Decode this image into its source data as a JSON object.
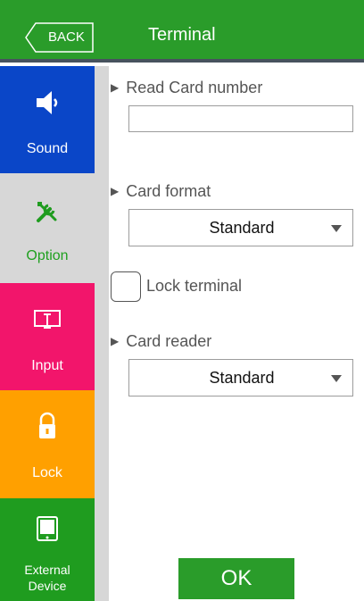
{
  "header": {
    "back_label": "BACK",
    "title": "Terminal"
  },
  "sidebar": {
    "items": [
      {
        "label": "Sound",
        "icon": "speaker-icon",
        "color": "#0a46c8"
      },
      {
        "label": "Option",
        "icon": "tools-icon",
        "color": "#d7d7d7",
        "selected": true
      },
      {
        "label": "Input",
        "icon": "input-icon",
        "color": "#f2156b"
      },
      {
        "label": "Lock",
        "icon": "lock-icon",
        "color": "#ffa000"
      },
      {
        "label_line1": "External",
        "label_line2": "Device",
        "icon": "device-icon",
        "color": "#1f9c1f"
      }
    ]
  },
  "form": {
    "read_card_label": "Read Card number",
    "read_card_value": "",
    "card_format_label": "Card format",
    "card_format_value": "Standard",
    "lock_terminal_label": "Lock terminal",
    "lock_terminal_checked": false,
    "card_reader_label": "Card reader",
    "card_reader_value": "Standard"
  },
  "ok_label": "OK",
  "colors": {
    "header": "#2a9c2a",
    "header_border": "#47525e",
    "option_text": "#1fa01f"
  }
}
